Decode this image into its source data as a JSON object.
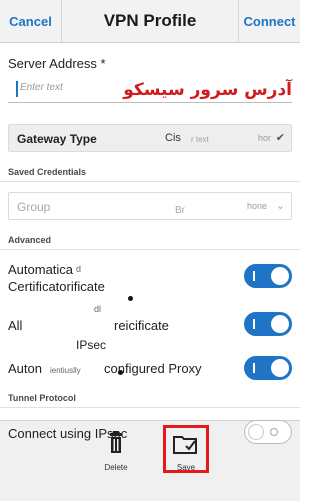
{
  "titlebar": {
    "cancel": "Cancel",
    "title": "VPN Profile",
    "connect": "Connect"
  },
  "server_address": {
    "label": "Server Address *",
    "placeholder": "Enter text",
    "annotation_fa": "آدرس سرور سیسکو"
  },
  "gateway": {
    "label": "Gateway Type",
    "middle": "Cis",
    "middle_small": "r text",
    "value": "hor"
  },
  "saved_credentials": {
    "section": "Saved Credentials",
    "group_label": "Group",
    "middle": "Br",
    "value": "hone"
  },
  "advanced": {
    "section": "Advanced",
    "row1": {
      "line1": "Automatica",
      "line1_small": "d",
      "line2": "Certificatorificate"
    },
    "row2": {
      "line1_small": "dl",
      "prefix": "All",
      "suffix": "reicificate"
    },
    "row3": {
      "line1": "IPsec",
      "prefix": "Auton",
      "small": "ientiuslly",
      "suffix": "configured Proxy"
    }
  },
  "tunnel": {
    "section": "Tunnel Protocol",
    "ipsec_label": "Connect using IPsec"
  },
  "toggles": [
    {
      "state": "on"
    },
    {
      "state": "on"
    },
    {
      "state": "on"
    },
    {
      "state": "off"
    }
  ],
  "bottom": {
    "delete_label": "Delete",
    "save_label": "Save"
  },
  "colors": {
    "accent": "#1d74c7",
    "toggle_on": "#1e75c6",
    "annotation": "#d21a1a",
    "highlight": "#e3191c"
  }
}
